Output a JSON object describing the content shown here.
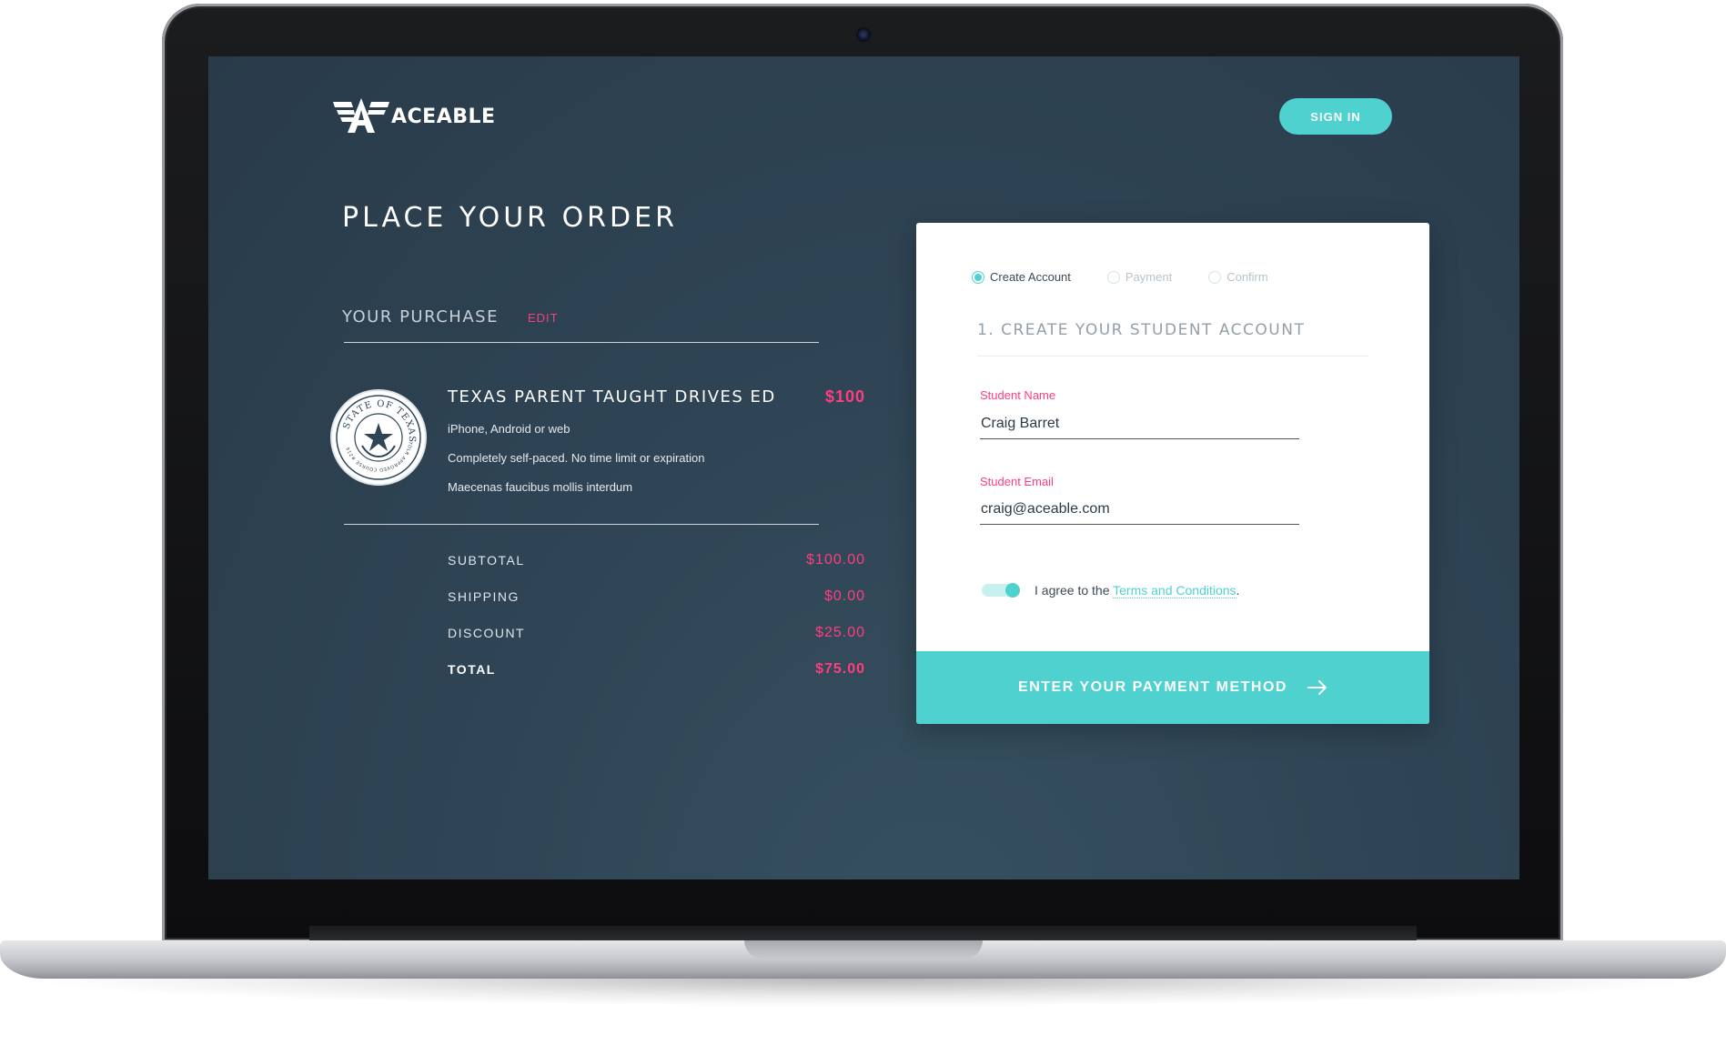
{
  "header": {
    "logo_text": "ACEABLE",
    "sign_in_label": "SIGN IN"
  },
  "order": {
    "title": "PLACE YOUR ORDER",
    "purchase_label": "YOUR PURCHASE",
    "edit_label": "EDIT",
    "course": {
      "title": "TEXAS PARENT TAUGHT DRIVES ED",
      "price": "$100",
      "features": [
        "iPhone, Android or web",
        "Completely self-paced. No time limit or expiration",
        "Maecenas faucibus mollis interdum"
      ],
      "seal_text": "STATE OF TEXAS",
      "seal_subtext": "TDLR APPROVED COURSE #216"
    },
    "summary": [
      {
        "label": "SUBTOTAL",
        "value": "$100.00"
      },
      {
        "label": "SHIPPING",
        "value": "$0.00"
      },
      {
        "label": "DISCOUNT",
        "value": "$25.00"
      },
      {
        "label": "TOTAL",
        "value": "$75.00"
      }
    ]
  },
  "form": {
    "steps": [
      {
        "label": "Create Account",
        "active": true
      },
      {
        "label": "Payment",
        "active": false
      },
      {
        "label": "Confirm",
        "active": false
      }
    ],
    "heading": "1. CREATE YOUR STUDENT ACCOUNT",
    "name_label": "Student Name",
    "name_value": "Craig Barret",
    "email_label": "Student Email",
    "email_value": "craig@aceable.com",
    "agree_prefix": "I agree to the ",
    "terms_label": "Terms and Conditions",
    "agree_suffix": ".",
    "submit_label": "ENTER YOUR PAYMENT METHOD"
  },
  "colors": {
    "accent": "#4fd1cf",
    "price": "#ff3d7f",
    "screen_bg": "#2f4555"
  }
}
